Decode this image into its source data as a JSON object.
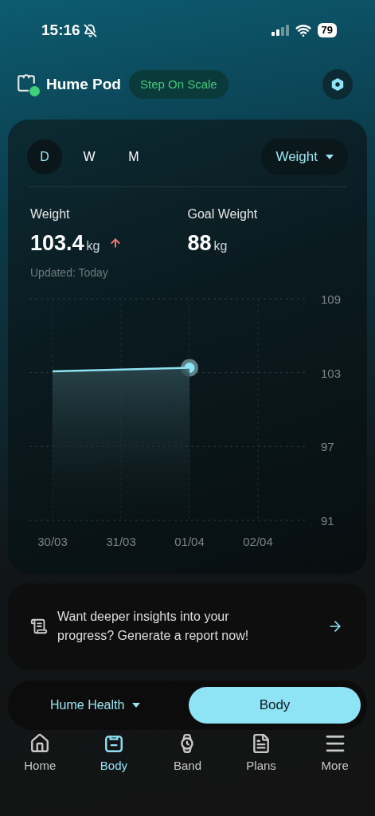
{
  "status_bar": {
    "time": "15:16",
    "battery": "79"
  },
  "header": {
    "device_name": "Hume Pod",
    "connected": true,
    "badge": "Step On Scale"
  },
  "period_tabs": [
    {
      "label": "D",
      "selected": true
    },
    {
      "label": "W",
      "selected": false
    },
    {
      "label": "M",
      "selected": false
    }
  ],
  "metric_dropdown": "Weight",
  "stats": [
    {
      "label": "Weight",
      "value": "103.4",
      "unit": "kg",
      "rising": true
    },
    {
      "label": "Goal Weight",
      "value": "88",
      "unit": "kg",
      "rising": false
    }
  ],
  "updated": "Updated: Today",
  "chart_data": {
    "type": "area",
    "categories": [
      "30/03",
      "31/03",
      "01/04",
      "02/04"
    ],
    "grid": true,
    "series": [
      {
        "color": "#8ee3f5",
        "values": [
          103.1,
          103.25,
          103.4,
          null
        ]
      }
    ],
    "ylim": [
      91,
      109
    ],
    "yticks": [
      91,
      97,
      103,
      109
    ]
  },
  "insight": {
    "text": "Want deeper insights into your progress? Generate a report now!"
  },
  "switcher": {
    "dropdown": "Hume Health",
    "button": "Body"
  },
  "nav": [
    {
      "label": "Home",
      "selected": false
    },
    {
      "label": "Body",
      "selected": true
    },
    {
      "label": "Band",
      "selected": false
    },
    {
      "label": "Plans",
      "selected": false
    },
    {
      "label": "More",
      "selected": false
    }
  ]
}
